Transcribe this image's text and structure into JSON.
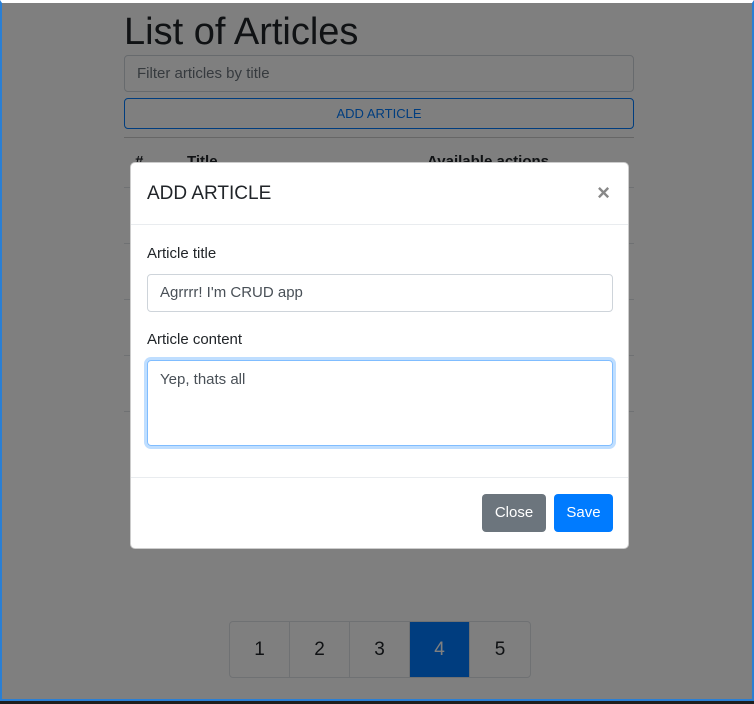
{
  "page": {
    "title": "List of Articles",
    "filter_placeholder": "Filter articles by title",
    "add_button": "ADD ARTICLE",
    "table_headers": [
      "#",
      "Title",
      "Available actions"
    ],
    "pagination": {
      "pages": [
        "1",
        "2",
        "3",
        "4",
        "5"
      ],
      "active": "4"
    }
  },
  "modal": {
    "title": "ADD ARTICLE",
    "close_icon": "×",
    "title_label": "Article title",
    "title_value": "Agrrrr! I'm CRUD app",
    "content_label": "Article content",
    "content_value": "Yep, thats all",
    "close_button": "Close",
    "save_button": "Save"
  },
  "colors": {
    "primary": "#007bff",
    "secondary": "#6c757d"
  }
}
